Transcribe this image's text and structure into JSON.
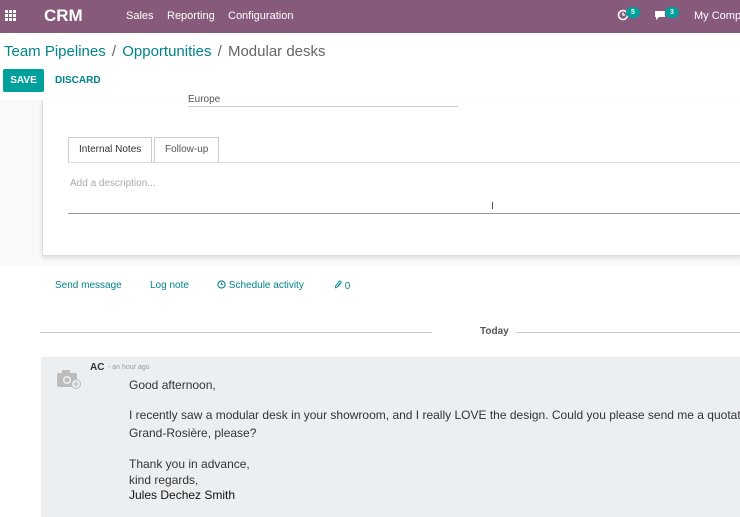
{
  "topbar": {
    "brand": "CRM",
    "menu": [
      "Sales",
      "Reporting",
      "Configuration"
    ],
    "activity_count": "5",
    "messages_count": "3",
    "company": "My Compa",
    "color": "#875a7b"
  },
  "breadcrumb": {
    "items": [
      "Team Pipelines",
      "Opportunities"
    ],
    "current": "Modular desks",
    "separator": "/"
  },
  "buttons": {
    "save": "SAVE",
    "discard": "DISCARD"
  },
  "form": {
    "country_value": "Europe",
    "tabs": [
      "Internal Notes",
      "Follow-up"
    ],
    "description_placeholder": "Add a description..."
  },
  "chatter": {
    "send_message": "Send message",
    "log_note": "Log note",
    "schedule_activity": "Schedule activity",
    "attachments": "0",
    "date_separator": "Today"
  },
  "message": {
    "author": "AC",
    "time": "- an hour ago",
    "lines": [
      "Good afternoon,",
      "I recently saw a modular desk in your showroom, and I really LOVE the design. Could you please send me a quotation",
      "Grand-Rosière, please?",
      "Thank you in advance,",
      "kind regards,",
      "Jules Dechez Smith"
    ]
  },
  "colors": {
    "accent": "#00a09d",
    "link": "#00838a"
  }
}
